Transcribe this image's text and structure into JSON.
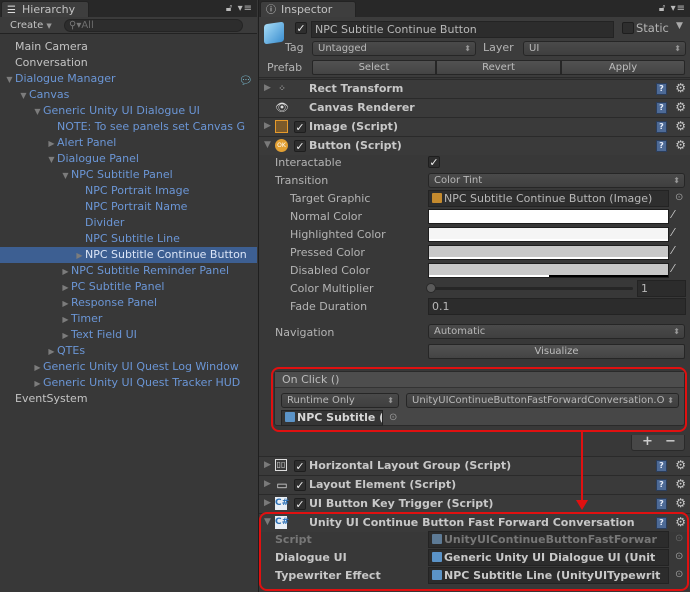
{
  "hierarchy": {
    "tab_label": "Hierarchy",
    "create_label": "Create",
    "search_placeholder": "All",
    "items": [
      {
        "label": "Main Camera",
        "depth": 0,
        "arrow": "",
        "color": "white"
      },
      {
        "label": "Conversation",
        "depth": 0,
        "arrow": "",
        "color": "white"
      },
      {
        "label": "Dialogue Manager",
        "depth": 0,
        "arrow": "down",
        "color": "blue",
        "scene_icon": true
      },
      {
        "label": "Canvas",
        "depth": 1,
        "arrow": "down",
        "color": "blue"
      },
      {
        "label": "Generic Unity UI Dialogue UI",
        "depth": 2,
        "arrow": "down",
        "color": "blue"
      },
      {
        "label": "NOTE: To see panels set Canvas G",
        "depth": 3,
        "arrow": "",
        "color": "blue"
      },
      {
        "label": "Alert Panel",
        "depth": 3,
        "arrow": "right",
        "color": "blue"
      },
      {
        "label": "Dialogue Panel",
        "depth": 3,
        "arrow": "down",
        "color": "blue"
      },
      {
        "label": "NPC Subtitle Panel",
        "depth": 4,
        "arrow": "down",
        "color": "blue"
      },
      {
        "label": "NPC Portrait Image",
        "depth": 5,
        "arrow": "",
        "color": "blue"
      },
      {
        "label": "NPC Portrait Name",
        "depth": 5,
        "arrow": "",
        "color": "blue"
      },
      {
        "label": "Divider",
        "depth": 5,
        "arrow": "",
        "color": "blue"
      },
      {
        "label": "NPC Subtitle Line",
        "depth": 5,
        "arrow": "",
        "color": "blue"
      },
      {
        "label": "NPC Subtitle Continue Button",
        "depth": 5,
        "arrow": "right",
        "color": "blue",
        "selected": true
      },
      {
        "label": "NPC Subtitle Reminder Panel",
        "depth": 4,
        "arrow": "right",
        "color": "blue"
      },
      {
        "label": "PC Subtitle Panel",
        "depth": 4,
        "arrow": "right",
        "color": "blue"
      },
      {
        "label": "Response Panel",
        "depth": 4,
        "arrow": "right",
        "color": "blue"
      },
      {
        "label": "Timer",
        "depth": 4,
        "arrow": "right",
        "color": "blue"
      },
      {
        "label": "Text Field UI",
        "depth": 4,
        "arrow": "right",
        "color": "blue"
      },
      {
        "label": "QTEs",
        "depth": 3,
        "arrow": "right",
        "color": "blue"
      },
      {
        "label": "Generic Unity UI Quest Log Window",
        "depth": 2,
        "arrow": "right",
        "color": "blue"
      },
      {
        "label": "Generic Unity UI Quest Tracker HUD",
        "depth": 2,
        "arrow": "right",
        "color": "blue"
      },
      {
        "label": "EventSystem",
        "depth": 0,
        "arrow": "",
        "color": "white"
      }
    ]
  },
  "inspector": {
    "tab_label": "Inspector",
    "object_name": "NPC Subtitle Continue Button",
    "active": true,
    "static_label": "Static",
    "static": false,
    "tag_label": "Tag",
    "tag_value": "Untagged",
    "layer_label": "Layer",
    "layer_value": "UI",
    "prefab_label": "Prefab",
    "prefab_buttons": [
      "Select",
      "Revert",
      "Apply"
    ],
    "components": {
      "rect_transform": "Rect Transform",
      "canvas_renderer": "Canvas Renderer",
      "image": "Image (Script)",
      "button": "Button (Script)",
      "horizontal_layout": "Horizontal Layout Group (Script)",
      "layout_element": "Layout Element (Script)",
      "key_trigger": "UI Button Key Trigger (Script)",
      "fast_forward": "Unity UI Continue Button Fast Forward Conversation"
    },
    "button": {
      "interactable_label": "Interactable",
      "interactable": true,
      "transition_label": "Transition",
      "transition_value": "Color Tint",
      "target_graphic_label": "Target Graphic",
      "target_graphic_value": "NPC Subtitle Continue Button (Image)",
      "normal_color_label": "Normal Color",
      "normal_color": "#ffffff",
      "highlighted_color_label": "Highlighted Color",
      "highlighted_color": "#f5f5f5",
      "pressed_color_label": "Pressed Color",
      "pressed_color": "#c8c8c8",
      "disabled_color_label": "Disabled Color",
      "disabled_color": "#c8c8c8",
      "disabled_alpha": 0.5,
      "color_multiplier_label": "Color Multiplier",
      "color_multiplier": "1",
      "color_multiplier_fraction": 0,
      "fade_duration_label": "Fade Duration",
      "fade_duration": "0.1",
      "navigation_label": "Navigation",
      "navigation_value": "Automatic",
      "visualize_label": "Visualize",
      "on_click_label": "On Click ()",
      "runtime_value": "Runtime Only",
      "function_value": "UnityUIContinueButtonFastForwardConversation.O",
      "object_value": "NPC Subtitle (",
      "add_label": "+",
      "remove_label": "−"
    },
    "fast_forward": {
      "script_label": "Script",
      "script_value": "UnityUIContinueButtonFastForwar",
      "dialogue_ui_label": "Dialogue UI",
      "dialogue_ui_value": "Generic Unity UI Dialogue UI (Unit",
      "typewriter_label": "Typewriter Effect",
      "typewriter_value": "NPC Subtitle Line (UnityUITypewrit"
    }
  },
  "colors": {
    "selection": "#3d5f92",
    "hierarchy_blue": "#6b96d6",
    "annotation_red": "#e01010"
  }
}
